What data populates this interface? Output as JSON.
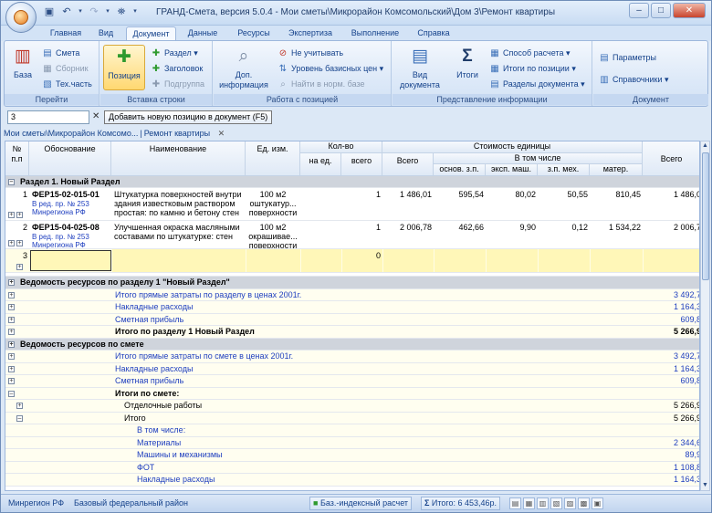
{
  "window": {
    "title": "ГРАНД-Смета, версия 5.0.4 - Мои сметы\\Микрорайон Комсомольский\\Дом 3\\Ремонт квартиры"
  },
  "tabs": [
    "Главная",
    "Вид",
    "Документ",
    "Данные",
    "Ресурсы",
    "Экспертиза",
    "Выполнение",
    "Справка"
  ],
  "ribbon": {
    "go": {
      "label": "Перейти",
      "base": "База",
      "smeta": "Смета",
      "sbornik": "Сборник",
      "tech": "Тех.часть"
    },
    "insert": {
      "label": "Вставка строки",
      "position": "Позиция",
      "razdel": "Раздел",
      "zagolovok": "Заголовок",
      "podgruppa": "Подгруппа"
    },
    "work": {
      "label": "Работа с позицией",
      "dop": "Доп.",
      "info": "информация",
      "ne_uchit": "Не учитывать",
      "uroven": "Уровень базисных цен",
      "naiti": "Найти в норм. базе"
    },
    "view": {
      "label": "Представление информации",
      "vid": "Вид",
      "dokumenta": "документа",
      "itogi": "Итоги",
      "sposob": "Способ расчета",
      "itogi_pos": "Итоги по позиции",
      "razdely": "Разделы документа"
    },
    "doc": {
      "label": "Документ",
      "params": "Параметры",
      "sprav": "Справочники"
    }
  },
  "formula_bar": {
    "value": "3",
    "tooltip": "Добавить новую позицию в документ (F5)"
  },
  "breadcrumbs": [
    "Мои сметы\\Микрорайон Комсомо...",
    "Ремонт квартиры"
  ],
  "columns": {
    "num": "№",
    "pp": "п.п",
    "obosn": "Обоснование",
    "naim": "Наименование",
    "ed": "Ед. изм.",
    "kolvo": "Кол-во",
    "na_ed": "на ед.",
    "vsego": "всего",
    "stoim": "Стоимость единицы",
    "v_tom": "В том числе",
    "vsego2": "Всего",
    "osn_zp": "основ. з.п.",
    "eksp": "эксп. маш.",
    "zp_meh": "з.п. мех.",
    "mater": "матер.",
    "vsego3": "Всего"
  },
  "section1": "Раздел 1. Новый Раздел",
  "positions": [
    {
      "num": "1",
      "code": "ФЕР15-02-015-01",
      "red": "В ред. пр. № 253",
      "reg": "Минрегиона РФ",
      "name1": "Штукатурка поверхностей внутри",
      "name2": "здания известковым раствором",
      "name3": "простая: по камню и бетону стен",
      "ed1": "100 м2",
      "ed2": "оштукатур...",
      "ed3": "поверхности",
      "qty": "1",
      "total": "1 486,01",
      "zp": "595,54",
      "mash": "80,02",
      "meh": "50,55",
      "mat": "810,45",
      "all": "1 486,0"
    },
    {
      "num": "2",
      "code": "ФЕР15-04-025-08",
      "red": "В ред. пр. № 253",
      "reg": "Минрегиона РФ",
      "name1": "Улучшенная окраска масляными",
      "name2": "составами по штукатурке: стен",
      "name3": "",
      "ed1": "100 м2",
      "ed2": "окрашивае...",
      "ed3": "поверхности",
      "qty": "1",
      "total": "2 006,78",
      "zp": "462,66",
      "mash": "9,90",
      "meh": "0,12",
      "mat": "1 534,22",
      "all": "2 006,7"
    }
  ],
  "new_row": {
    "num": "3",
    "qty": "0"
  },
  "summary": [
    {
      "label": "Ведомость ресурсов по разделу 1 \"Новый Раздел\"",
      "value": "",
      "type": "sec"
    },
    {
      "label": "Итого прямые затраты по разделу в ценах 2001г.",
      "value": "3 492,7",
      "type": "blue"
    },
    {
      "label": "Накладные расходы",
      "value": "1 164,3",
      "type": "blue"
    },
    {
      "label": "Сметная прибыль",
      "value": "609,8",
      "type": "blue"
    },
    {
      "label": "Итого по разделу 1 Новый Раздел",
      "value": "5 266,9",
      "type": "bold"
    },
    {
      "label": "Ведомость ресурсов по смете",
      "value": "",
      "type": "sec"
    },
    {
      "label": "Итого прямые затраты по смете в ценах 2001г.",
      "value": "3 492,7",
      "type": "blue"
    },
    {
      "label": "Накладные расходы",
      "value": "1 164,3",
      "type": "blue"
    },
    {
      "label": "Сметная прибыль",
      "value": "609,8",
      "type": "blue"
    },
    {
      "label": "Итоги по смете:",
      "value": "",
      "type": "bold"
    },
    {
      "label": "Отделочные работы",
      "value": "5 266,9",
      "type": "plain1"
    },
    {
      "label": "Итого",
      "value": "5 266,9",
      "type": "plain1"
    },
    {
      "label": "В том числе:",
      "value": "",
      "type": "blue2"
    },
    {
      "label": "Материалы",
      "value": "2 344,6",
      "type": "blue2"
    },
    {
      "label": "Машины и механизмы",
      "value": "89,9",
      "type": "blue2"
    },
    {
      "label": "ФОТ",
      "value": "1 108,8",
      "type": "blue2"
    },
    {
      "label": "Накладные расходы",
      "value": "1 164,3",
      "type": "blue2"
    }
  ],
  "status": {
    "region": "Минрегион РФ",
    "base": "Базовый федеральный район",
    "calc": "Баз.-индексный расчет",
    "total": "Итого: 6 453,46р."
  }
}
